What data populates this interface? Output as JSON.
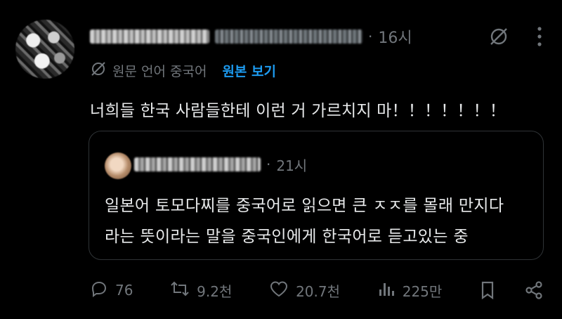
{
  "post": {
    "author_name": "",
    "author_handle": "",
    "separator": "·",
    "time": "16시",
    "translate": {
      "source_label": "원문 언어 중국어",
      "show_original_link": "원본 보기"
    },
    "text": "너희들 한국 사람들한테 이런 거 가르치지 마！！！！！！！"
  },
  "quoted_post": {
    "separator": "·",
    "time": "21시",
    "lines": [
      "일본어 토모다찌를 중국어로 읽으면 큰 ㅈㅈ를 몰래 만지다",
      "라는 뜻이라는 말을 중국인에게 한국어로 듣고있는 중"
    ]
  },
  "actions": {
    "replies": "76",
    "reposts": "9.2천",
    "likes": "20.7천",
    "views": "225만"
  },
  "icons": {
    "grok": "grok-icon",
    "more": "more-icon",
    "translate": "translate-icon",
    "reply": "reply-icon",
    "repost": "repost-icon",
    "like": "like-icon",
    "views": "views-icon",
    "bookmark": "bookmark-icon",
    "share": "share-icon"
  },
  "colors": {
    "background": "#000000",
    "text": "#e7e9ea",
    "muted": "#71767b",
    "link": "#1d9bf0",
    "border": "#2f3336"
  }
}
